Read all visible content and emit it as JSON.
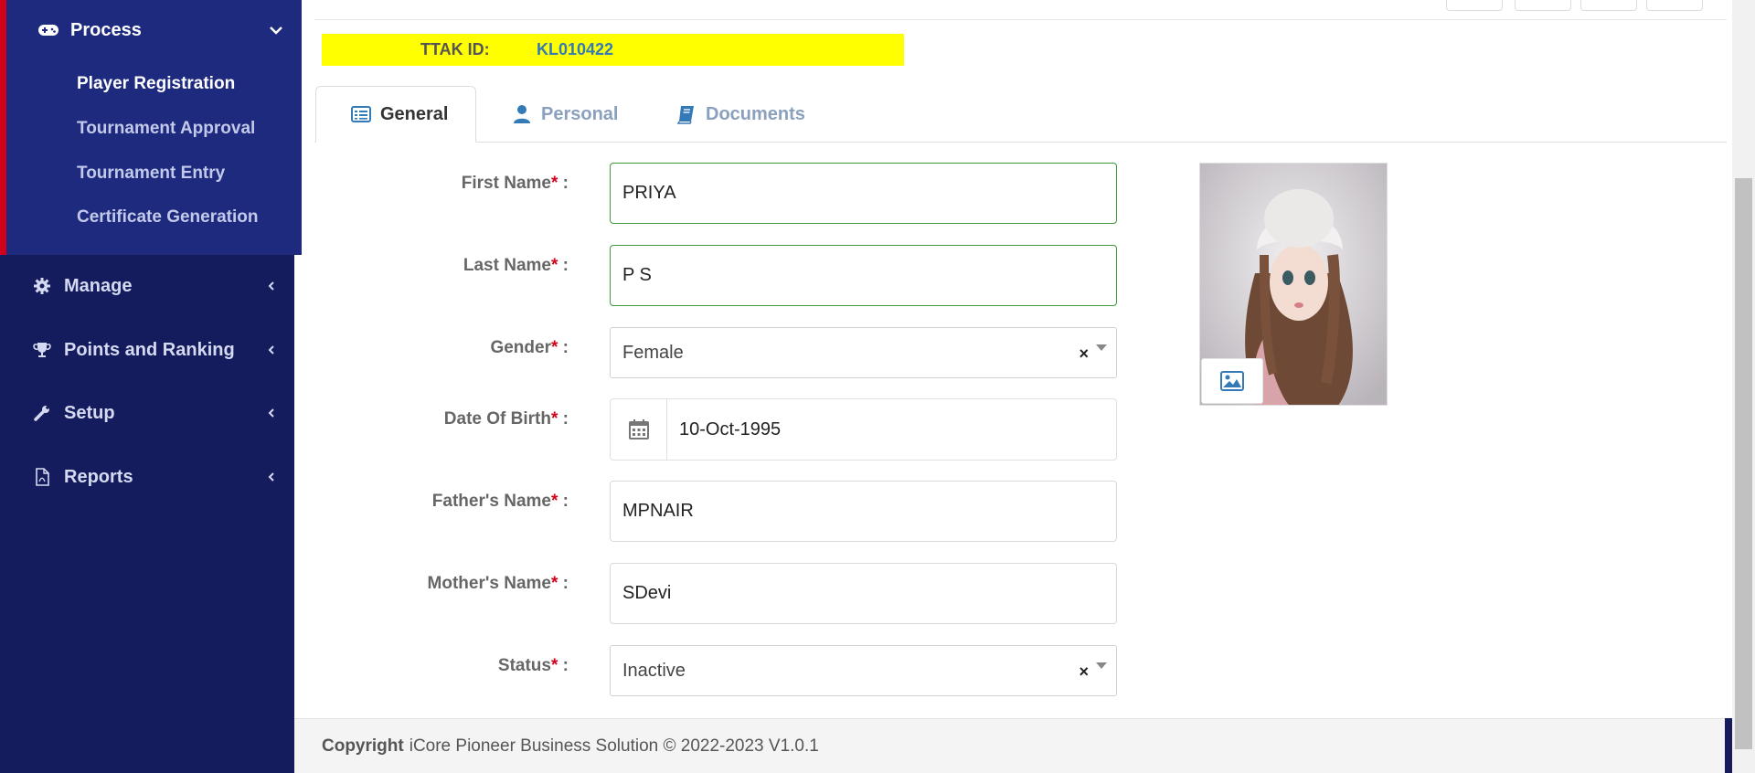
{
  "sidebar": {
    "process": {
      "label": "Process",
      "items": [
        {
          "label": "Player Registration",
          "active": true
        },
        {
          "label": "Tournament Approval",
          "active": false
        },
        {
          "label": "Tournament Entry",
          "active": false
        },
        {
          "label": "Certificate Generation",
          "active": false
        }
      ]
    },
    "nav": [
      {
        "label": "Manage",
        "icon": "gear-icon"
      },
      {
        "label": "Points and Ranking",
        "icon": "trophy-icon"
      },
      {
        "label": "Setup",
        "icon": "wrench-icon"
      },
      {
        "label": "Reports",
        "icon": "pdf-file-icon"
      }
    ]
  },
  "header": {
    "ttak_label": "TTAK ID:",
    "ttak_value": "KL010422"
  },
  "tabs": [
    {
      "label": "General",
      "icon": "list-alt-icon",
      "active": true
    },
    {
      "label": "Personal",
      "icon": "user-icon",
      "active": false
    },
    {
      "label": "Documents",
      "icon": "book-icon",
      "active": false
    }
  ],
  "form": {
    "required_mark": "*",
    "first_name": {
      "label": "First Name",
      "value": "PRIYA"
    },
    "last_name": {
      "label": "Last Name",
      "value": "P S"
    },
    "gender": {
      "label": "Gender",
      "value": "Female"
    },
    "dob": {
      "label": "Date Of Birth",
      "value": "10-Oct-1995"
    },
    "father_name": {
      "label": "Father's Name",
      "value": "MPNAIR"
    },
    "mother_name": {
      "label": "Mother's Name",
      "value": "SDevi"
    },
    "status": {
      "label": "Status",
      "value": "Inactive"
    }
  },
  "select_clear": "×",
  "footer": {
    "brand": "Copyright",
    "text": "iCore Pioneer Business Solution © 2022-2023 V1.0.1"
  },
  "colors": {
    "sidebar_bg": "#141c5e",
    "process_bg": "#1e2a7e",
    "accent_red": "#d0021b",
    "highlight_yellow": "#ffff00",
    "link_blue": "#337ab7",
    "valid_green": "#3c9a3c"
  }
}
